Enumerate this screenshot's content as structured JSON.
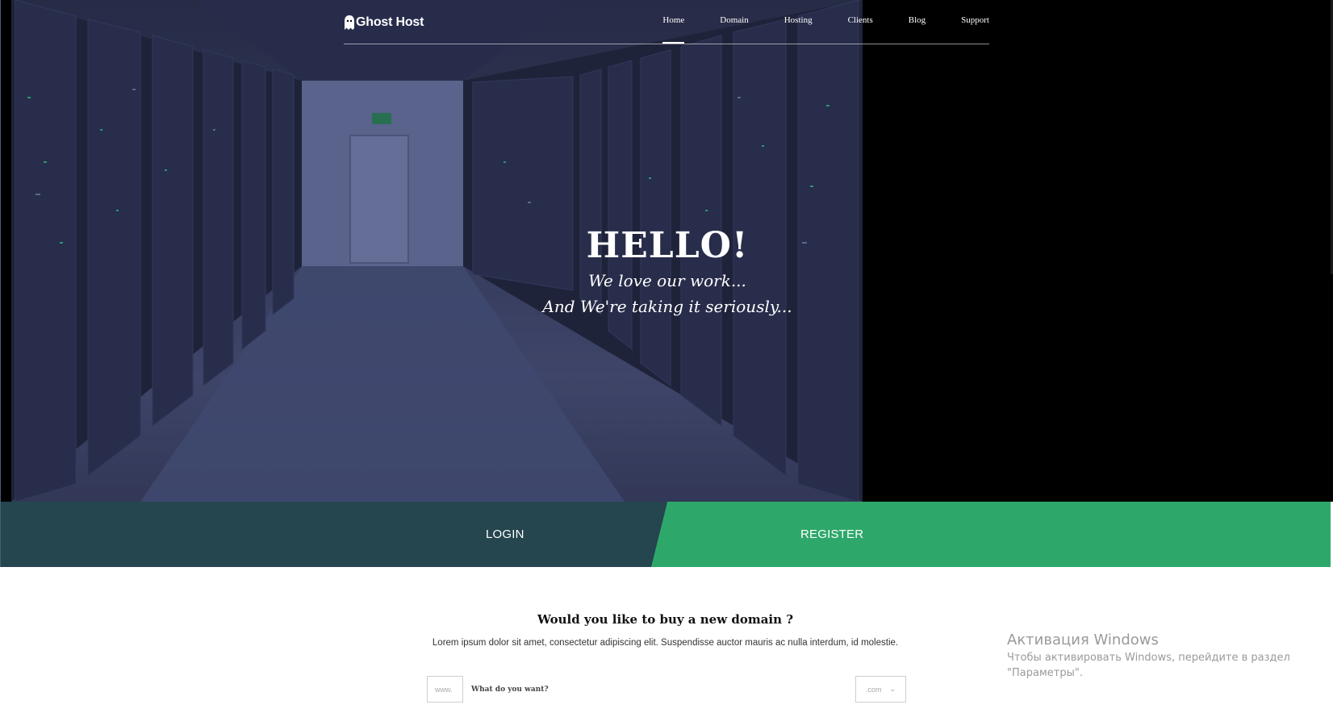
{
  "brand": {
    "name": "Ghost Host"
  },
  "nav": {
    "items": [
      {
        "label": "Home",
        "active": true
      },
      {
        "label": "Domain",
        "active": false
      },
      {
        "label": "Hosting",
        "active": false
      },
      {
        "label": "Clients",
        "active": false
      },
      {
        "label": "Blog",
        "active": false
      },
      {
        "label": "Support",
        "active": false
      }
    ]
  },
  "hero": {
    "title": "HELLO!",
    "line1": "We love our work...",
    "line2": "And We're taking it seriously..."
  },
  "cta": {
    "login_label": "LOGIN",
    "register_label": "REGISTER"
  },
  "domain": {
    "title": "Would you like to buy a new domain ?",
    "description": "Lorem ipsum dolor sit amet, consectetur adipiscing elit. Suspendisse auctor mauris ac nulla interdum, id molestie.",
    "prefix": "www.",
    "placeholder": "What do you want?",
    "tld": ".com"
  },
  "watermark": {
    "title": "Активация Windows",
    "line1": "Чтобы активировать Windows, перейдите в раздел",
    "line2": "\"Параметры\"."
  },
  "colors": {
    "login_bg": "#25454f",
    "register_bg": "#2ea86a",
    "hero_overlay": "#3b4264"
  }
}
